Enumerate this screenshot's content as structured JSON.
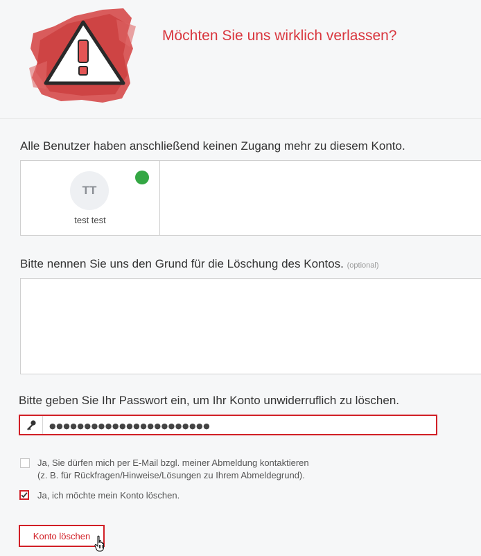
{
  "header": {
    "title": "Möchten Sie uns wirklich verlassen?",
    "icon": "warning-icon",
    "accent_color": "#d9363e"
  },
  "users_section": {
    "label": "Alle Benutzer haben anschließend keinen Zugang mehr zu diesem Konto.",
    "users": [
      {
        "initials": "TT",
        "name": "test test",
        "status_color": "#34a744"
      }
    ]
  },
  "reason_section": {
    "label": "Bitte nennen Sie uns den Grund für die Löschung des Kontos.",
    "optional": "(optional)",
    "value": ""
  },
  "password_section": {
    "label": "Bitte geben Sie Ihr Passwort ein, um Ihr Konto unwiderruflich zu löschen.",
    "value": "●●●●●●●●●●●●●●●●●●●●●●●",
    "icon": "key-icon"
  },
  "checkboxes": [
    {
      "line1": "Ja, Sie dürfen mich per E-Mail bzgl. meiner Abmeldung kontaktieren",
      "line2": "(z. B. für Rückfragen/Hinweise/Lösungen zu Ihrem Abmeldegrund).",
      "checked": false
    },
    {
      "line1": "Ja, ich möchte mein Konto löschen.",
      "checked": true
    }
  ],
  "delete_button": {
    "label": "Konto löschen",
    "color": "#d11f26"
  }
}
